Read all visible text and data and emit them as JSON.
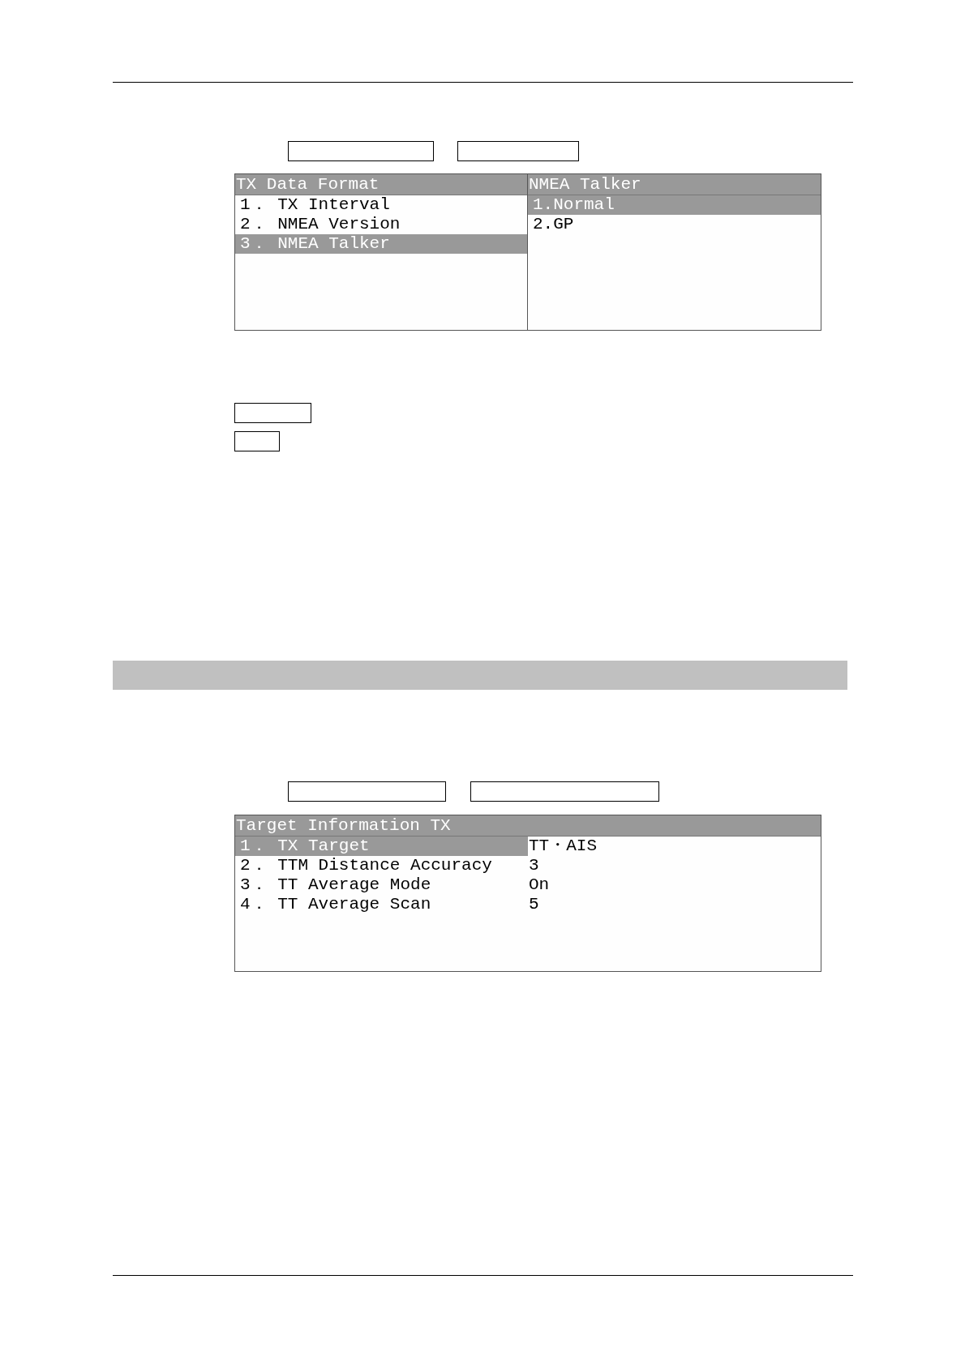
{
  "menu_1": {
    "panes": [
      {
        "title": "TX Data Format",
        "items": [
          {
            "label": "1． TX Interval",
            "selected": false
          },
          {
            "label": "2． NMEA Version",
            "selected": false
          },
          {
            "label": "3． NMEA Talker",
            "selected": true
          }
        ]
      },
      {
        "title": "NMEA Talker",
        "items": [
          {
            "label": "1.Normal",
            "selected": true
          },
          {
            "label": "2.GP",
            "selected": false
          }
        ]
      }
    ]
  },
  "menu_2": {
    "title": "Target Information TX",
    "rows": [
      {
        "label": "1． TX Target",
        "value": "TT・AIS",
        "selected": true
      },
      {
        "label": "2． TTM Distance Accuracy",
        "value": "3",
        "selected": false
      },
      {
        "label": "3． TT Average Mode",
        "value": "On",
        "selected": false
      },
      {
        "label": "4． TT Average Scan",
        "value": "5",
        "selected": false
      }
    ]
  }
}
